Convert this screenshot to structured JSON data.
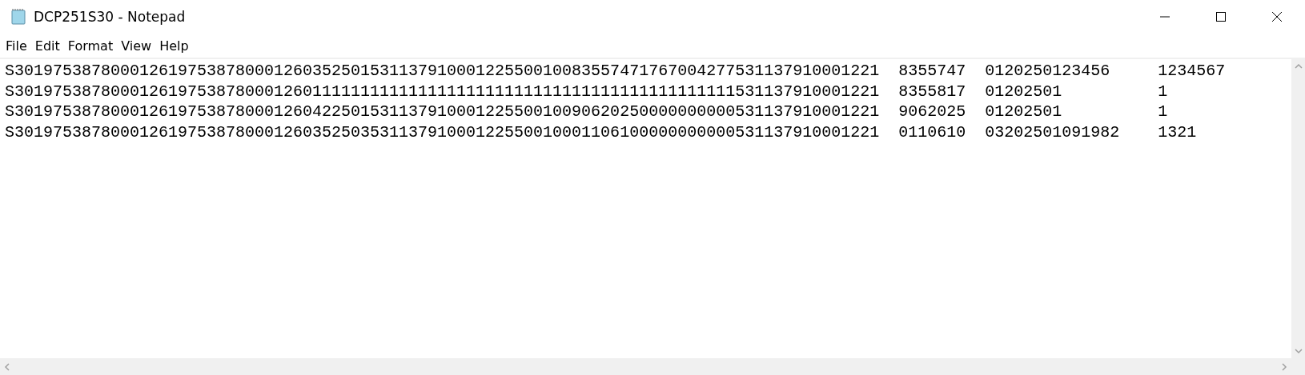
{
  "window": {
    "title": "DCP251S30 - Notepad"
  },
  "menu": [
    "File",
    "Edit",
    "Format",
    "View",
    "Help"
  ],
  "lines": [
    "S301975387800012619753878000126035250153113791000122550010083557471767004277531137910001221  8355747  0120250123456     1234567",
    "S301975387800012619753878000126011111111111111111111111111111111111111111111531137910001221  8355817  01202501          1",
    "S301975387800012619753878000126042250153113791000122550010090620250000000000531137910001221  9062025  01202501          1",
    "S301975387800012619753878000126035250353113791000122550010001106100000000000531137910001221  0110610  03202501091982    1321"
  ]
}
